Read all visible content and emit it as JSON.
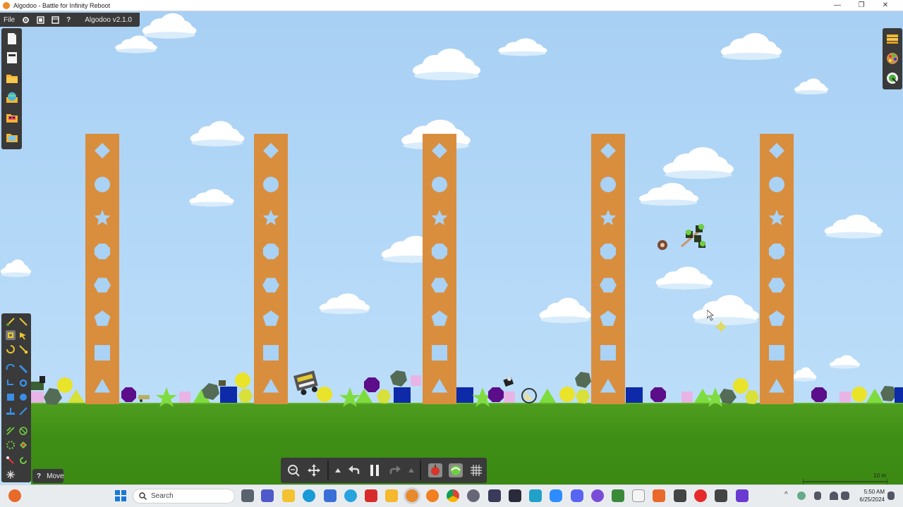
{
  "window": {
    "title": "Algodoo - Battle for Infinity Reboot",
    "minimize_glyph": "—",
    "maximize_glyph": "❐",
    "close_glyph": "✕"
  },
  "toolbar": {
    "file_label": "File",
    "help_label": "?",
    "version": "Algodoo v2.1.0"
  },
  "tools": {
    "help_label": "?",
    "active_tool_label": "Move"
  },
  "sim_controls": {
    "icons": [
      "zoom-icon",
      "pan-icon",
      "speed-down-icon",
      "undo-icon",
      "pause-icon",
      "redo-icon",
      "speed-up-icon",
      "gravity-icon",
      "air-friction-icon",
      "grid-icon"
    ]
  },
  "scene": {
    "scale_label": "10 m",
    "pillar_hole_shapes": [
      "diamond",
      "circle",
      "star",
      "octagon",
      "hexagon",
      "pentagon",
      "square",
      "triangle"
    ],
    "colors": {
      "sky": "#a9d2f5",
      "ground": "#3f8f16",
      "pillar": "#d98e3e",
      "purple": "#5b0d8a",
      "blue": "#0d2aa8",
      "yellow": "#e9e32a",
      "green": "#7fdc3e",
      "pink": "#e8b4e6",
      "gray": "#546b55"
    }
  },
  "taskbar": {
    "search_placeholder": "Search",
    "time": "5:50 AM",
    "date": "6/25/2024"
  }
}
